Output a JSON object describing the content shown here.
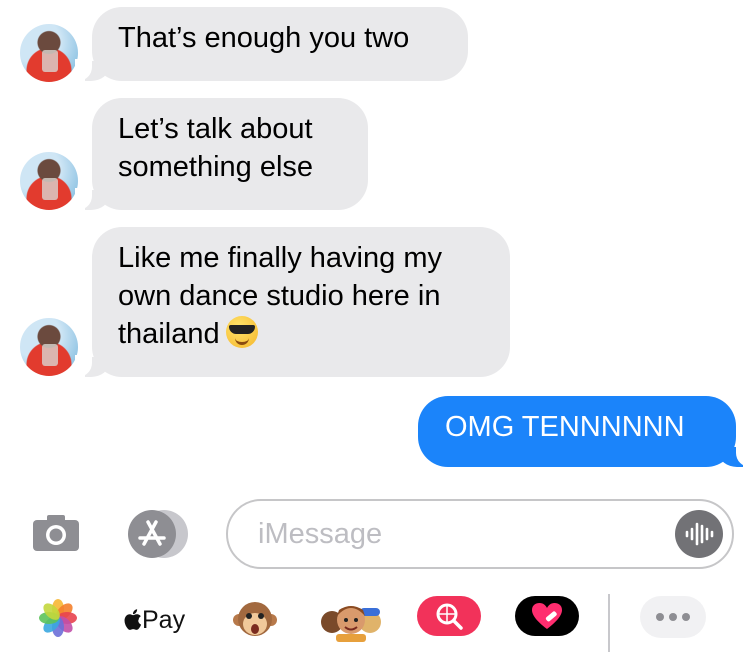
{
  "messages": [
    {
      "direction": "in",
      "lines": [
        "That’s enough you two"
      ]
    },
    {
      "direction": "in",
      "lines": [
        "Let’s talk about",
        "something else"
      ]
    },
    {
      "direction": "in",
      "lines": [
        "Like me finally having my",
        "own dance studio here in",
        "thailand"
      ],
      "emoji": "sunglasses-emoji"
    },
    {
      "direction": "out",
      "lines": [
        "OMG TENNNNNN"
      ]
    }
  ],
  "composer": {
    "placeholder": "iMessage",
    "left_icons": [
      "camera-icon",
      "app-store-icon"
    ],
    "right_icon": "audio-waveform-icon"
  },
  "app_drawer": {
    "items": [
      "photos-icon",
      "apple-pay",
      "animoji-monkey-icon",
      "memoji-icon",
      "image-search-icon",
      "digital-touch-icon",
      "more-icon"
    ],
    "apple_pay_label": "Pay"
  },
  "colors": {
    "incoming_bubble": "#e9e9eb",
    "outgoing_bubble": "#1b84fa",
    "search_app": "#f2325a"
  }
}
